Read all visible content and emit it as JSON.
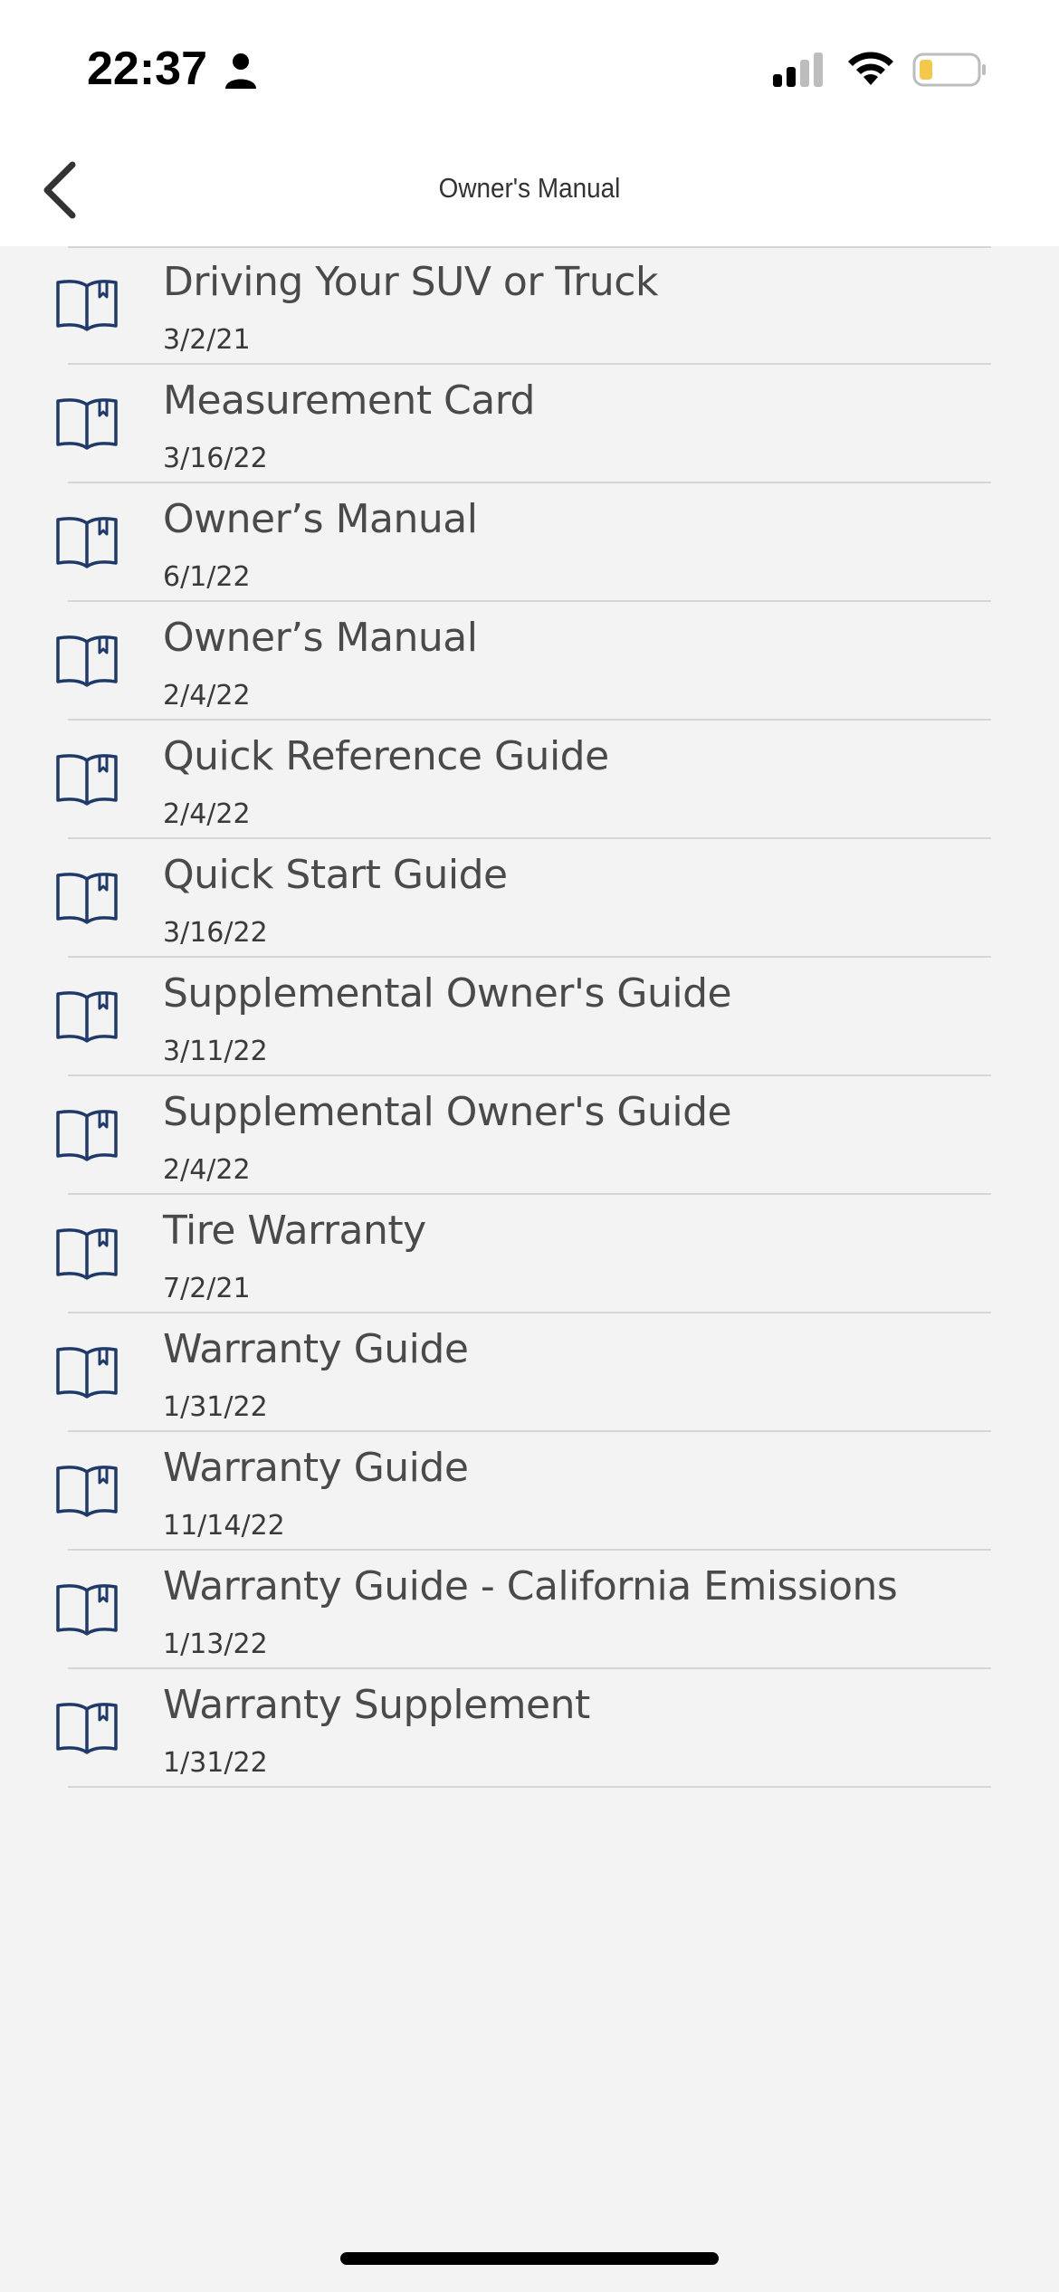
{
  "status_bar": {
    "time": "22:37",
    "icons": [
      "person-icon",
      "signal-icon",
      "wifi-icon",
      "battery-icon"
    ],
    "battery_color": "#f2c94c"
  },
  "nav": {
    "back_icon": "chevron-left-icon",
    "title": "Owner's Manual"
  },
  "colors": {
    "icon_color": "#1f3a68",
    "background": "#f3f3f3"
  },
  "documents": [
    {
      "title": "Driving Your SUV or Truck",
      "date": "3/2/21",
      "icon": "book-icon"
    },
    {
      "title": "Measurement Card",
      "date": "3/16/22",
      "icon": "book-icon"
    },
    {
      "title": "Owner’s Manual",
      "date": "6/1/22",
      "icon": "book-icon"
    },
    {
      "title": "Owner’s Manual",
      "date": "2/4/22",
      "icon": "book-icon"
    },
    {
      "title": "Quick Reference Guide",
      "date": "2/4/22",
      "icon": "book-icon"
    },
    {
      "title": "Quick Start Guide",
      "date": "3/16/22",
      "icon": "book-icon"
    },
    {
      "title": "Supplemental Owner's Guide",
      "date": "3/11/22",
      "icon": "book-icon"
    },
    {
      "title": "Supplemental Owner's Guide",
      "date": "2/4/22",
      "icon": "book-icon"
    },
    {
      "title": "Tire Warranty",
      "date": "7/2/21",
      "icon": "book-icon"
    },
    {
      "title": "Warranty Guide",
      "date": "1/31/22",
      "icon": "book-icon"
    },
    {
      "title": "Warranty Guide",
      "date": "11/14/22",
      "icon": "book-icon"
    },
    {
      "title": "Warranty Guide - California Emissions",
      "date": "1/13/22",
      "icon": "book-icon"
    },
    {
      "title": "Warranty Supplement",
      "date": "1/31/22",
      "icon": "book-icon"
    }
  ]
}
